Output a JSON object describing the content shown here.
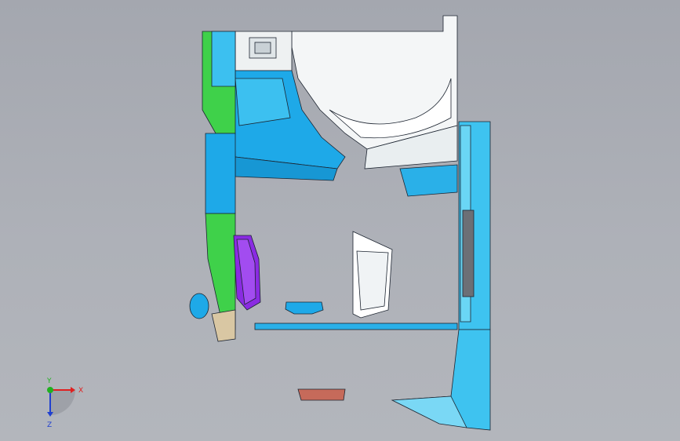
{
  "viewport": {
    "background": "#aeb1b8"
  },
  "colors": {
    "cyan_panel": "#1ea9e8",
    "light_cyan": "#5cd3f2",
    "green_trim": "#3fd14a",
    "white_panel": "#f4f6f7",
    "purple_seat": "#8a2be2",
    "outline": "#1c2430",
    "beige_part": "#d9c7a3",
    "red_part": "#c66a5a"
  },
  "triad": {
    "x_label": "X",
    "y_label": "Y",
    "z_label": "Z",
    "x_color": "#e02020",
    "y_color": "#20b020",
    "z_color": "#2040d0"
  }
}
